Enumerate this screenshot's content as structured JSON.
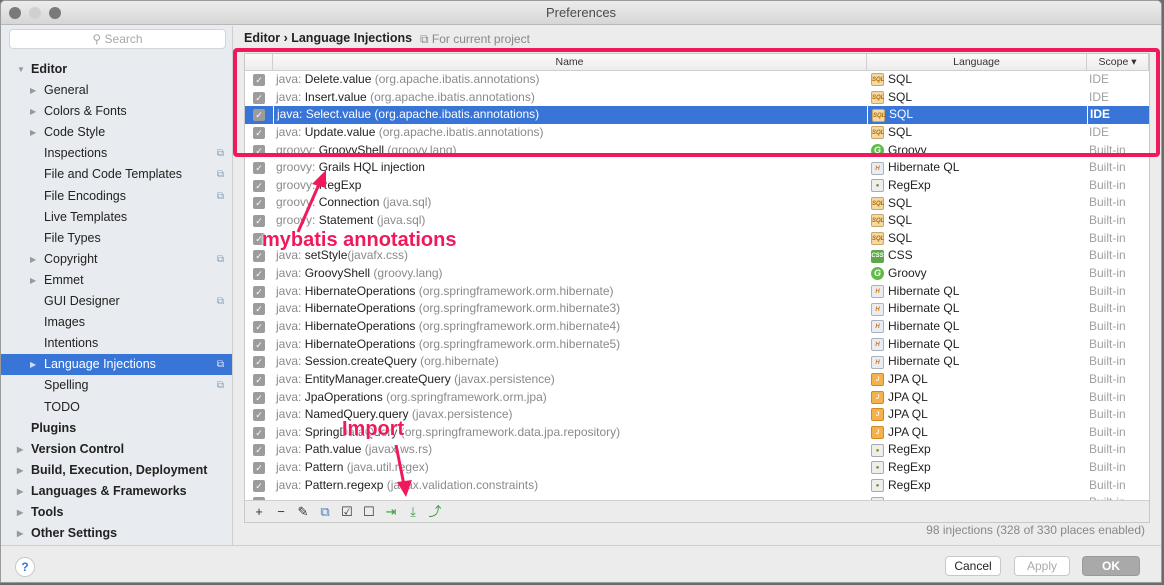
{
  "window": {
    "title": "Preferences"
  },
  "sidebar": {
    "search_placeholder": "Search",
    "items": [
      {
        "label": "Editor",
        "level": 0,
        "bold": true,
        "arrow": "down",
        "project": false
      },
      {
        "label": "General",
        "level": 1,
        "arrow": "right",
        "project": false
      },
      {
        "label": "Colors & Fonts",
        "level": 1,
        "arrow": "right",
        "project": false
      },
      {
        "label": "Code Style",
        "level": 1,
        "arrow": "right",
        "project": false
      },
      {
        "label": "Inspections",
        "level": 1,
        "project": true
      },
      {
        "label": "File and Code Templates",
        "level": 1,
        "project": true
      },
      {
        "label": "File Encodings",
        "level": 1,
        "project": true
      },
      {
        "label": "Live Templates",
        "level": 1,
        "project": false
      },
      {
        "label": "File Types",
        "level": 1,
        "project": false
      },
      {
        "label": "Copyright",
        "level": 1,
        "arrow": "right",
        "project": true
      },
      {
        "label": "Emmet",
        "level": 1,
        "arrow": "right",
        "project": false
      },
      {
        "label": "GUI Designer",
        "level": 1,
        "project": true
      },
      {
        "label": "Images",
        "level": 1,
        "project": false
      },
      {
        "label": "Intentions",
        "level": 1,
        "project": false
      },
      {
        "label": "Language Injections",
        "level": 1,
        "arrow": "right",
        "project": true,
        "selected": true
      },
      {
        "label": "Spelling",
        "level": 1,
        "project": true
      },
      {
        "label": "TODO",
        "level": 1,
        "project": false
      },
      {
        "label": "Plugins",
        "level": 0,
        "bold": true
      },
      {
        "label": "Version Control",
        "level": 0,
        "bold": true,
        "arrow": "right"
      },
      {
        "label": "Build, Execution, Deployment",
        "level": 0,
        "bold": true,
        "arrow": "right"
      },
      {
        "label": "Languages & Frameworks",
        "level": 0,
        "bold": true,
        "arrow": "right"
      },
      {
        "label": "Tools",
        "level": 0,
        "bold": true,
        "arrow": "right"
      },
      {
        "label": "Other Settings",
        "level": 0,
        "bold": true,
        "arrow": "right"
      }
    ]
  },
  "main": {
    "breadcrumb": "Editor › Language Injections",
    "scope_note": "For current project",
    "columns": {
      "name": "Name",
      "language": "Language",
      "scope": "Scope ▾"
    },
    "rows": [
      {
        "prefix": "java: ",
        "name": "Delete.value",
        "pkg": " (org.apache.ibatis.annotations)",
        "lang": "SQL",
        "icon": "sql",
        "scope": "IDE"
      },
      {
        "prefix": "java: ",
        "name": "Insert.value",
        "pkg": " (org.apache.ibatis.annotations)",
        "lang": "SQL",
        "icon": "sql",
        "scope": "IDE"
      },
      {
        "prefix": "java: ",
        "name": "Select.value",
        "pkg": " (org.apache.ibatis.annotations)",
        "lang": "SQL",
        "icon": "sql",
        "scope": "IDE",
        "selected": true
      },
      {
        "prefix": "java: ",
        "name": "Update.value",
        "pkg": " (org.apache.ibatis.annotations)",
        "lang": "SQL",
        "icon": "sql",
        "scope": "IDE"
      },
      {
        "prefix": "groovy: ",
        "name": "GroovyShell",
        "pkg": " (groovy.lang)",
        "lang": "Groovy",
        "icon": "groovy",
        "scope": "Built-in"
      },
      {
        "prefix": "groovy: ",
        "name": "Grails HQL injection",
        "pkg": "",
        "lang": "Hibernate QL",
        "icon": "hql",
        "scope": "Built-in"
      },
      {
        "prefix": "groovy: ",
        "name": "RegExp",
        "pkg": "",
        "lang": "RegExp",
        "icon": "regexp",
        "scope": "Built-in"
      },
      {
        "prefix": "groovy: ",
        "name": "Connection",
        "pkg": " (java.sql)",
        "lang": "SQL",
        "icon": "sql",
        "scope": "Built-in"
      },
      {
        "prefix": "groovy: ",
        "name": "Statement",
        "pkg": " (java.sql)",
        "lang": "SQL",
        "icon": "sql",
        "scope": "Built-in"
      },
      {
        "prefix": "",
        "name": "",
        "pkg": "",
        "lang": "SQL",
        "icon": "sql",
        "scope": "Built-in"
      },
      {
        "prefix": "java: ",
        "name": "setStyle",
        "pkg": "(javafx.css)",
        "lang": "CSS",
        "icon": "css",
        "scope": "Built-in"
      },
      {
        "prefix": "java: ",
        "name": "GroovyShell",
        "pkg": " (groovy.lang)",
        "lang": "Groovy",
        "icon": "groovy",
        "scope": "Built-in"
      },
      {
        "prefix": "java: ",
        "name": "HibernateOperations",
        "pkg": " (org.springframework.orm.hibernate)",
        "lang": "Hibernate QL",
        "icon": "hql",
        "scope": "Built-in"
      },
      {
        "prefix": "java: ",
        "name": "HibernateOperations",
        "pkg": " (org.springframework.orm.hibernate3)",
        "lang": "Hibernate QL",
        "icon": "hql",
        "scope": "Built-in"
      },
      {
        "prefix": "java: ",
        "name": "HibernateOperations",
        "pkg": " (org.springframework.orm.hibernate4)",
        "lang": "Hibernate QL",
        "icon": "hql",
        "scope": "Built-in"
      },
      {
        "prefix": "java: ",
        "name": "HibernateOperations",
        "pkg": " (org.springframework.orm.hibernate5)",
        "lang": "Hibernate QL",
        "icon": "hql",
        "scope": "Built-in"
      },
      {
        "prefix": "java: ",
        "name": "Session.createQuery",
        "pkg": " (org.hibernate)",
        "lang": "Hibernate QL",
        "icon": "hql",
        "scope": "Built-in"
      },
      {
        "prefix": "java: ",
        "name": "EntityManager.createQuery",
        "pkg": " (javax.persistence)",
        "lang": "JPA QL",
        "icon": "jpa",
        "scope": "Built-in"
      },
      {
        "prefix": "java: ",
        "name": "JpaOperations",
        "pkg": " (org.springframework.orm.jpa)",
        "lang": "JPA QL",
        "icon": "jpa",
        "scope": "Built-in"
      },
      {
        "prefix": "java: ",
        "name": "NamedQuery.query",
        "pkg": " (javax.persistence)",
        "lang": "JPA QL",
        "icon": "jpa",
        "scope": "Built-in"
      },
      {
        "prefix": "java: ",
        "name": "SpringDataQuery",
        "pkg": " (org.springframework.data.jpa.repository)",
        "lang": "JPA QL",
        "icon": "jpa",
        "scope": "Built-in"
      },
      {
        "prefix": "java: ",
        "name": "Path.value",
        "pkg": " (javax.ws.rs)",
        "lang": "RegExp",
        "icon": "regexp",
        "scope": "Built-in"
      },
      {
        "prefix": "java: ",
        "name": "Pattern",
        "pkg": " (java.util.regex)",
        "lang": "RegExp",
        "icon": "regexp",
        "scope": "Built-in"
      },
      {
        "prefix": "java: ",
        "name": "Pattern.regexp",
        "pkg": " (javax.validation.constraints)",
        "lang": "RegExp",
        "icon": "regexp",
        "scope": "Built-in"
      },
      {
        "prefix": "",
        "name": "",
        "pkg": "",
        "lang": "",
        "icon": "regexp",
        "scope": "Built-in"
      }
    ],
    "toolbar": [
      {
        "name": "add-icon",
        "glyph": "+"
      },
      {
        "name": "remove-icon",
        "glyph": "−"
      },
      {
        "name": "edit-icon",
        "glyph": "✎"
      },
      {
        "name": "copy-icon",
        "glyph": "⧉"
      },
      {
        "name": "enable-all-icon",
        "glyph": "☑"
      },
      {
        "name": "disable-all-icon",
        "glyph": "☐"
      },
      {
        "name": "import-file-icon",
        "glyph": "⇥"
      },
      {
        "name": "import-icon",
        "glyph": "⤓"
      },
      {
        "name": "export-icon",
        "glyph": "⤴"
      }
    ],
    "status": "98 injections (328 of 330 places enabled)"
  },
  "footer": {
    "help": "?",
    "cancel": "Cancel",
    "apply": "Apply",
    "ok": "OK"
  },
  "annotations": {
    "mybatis": "mybatis annotations",
    "import": "Import",
    "color": "#f0195c"
  }
}
